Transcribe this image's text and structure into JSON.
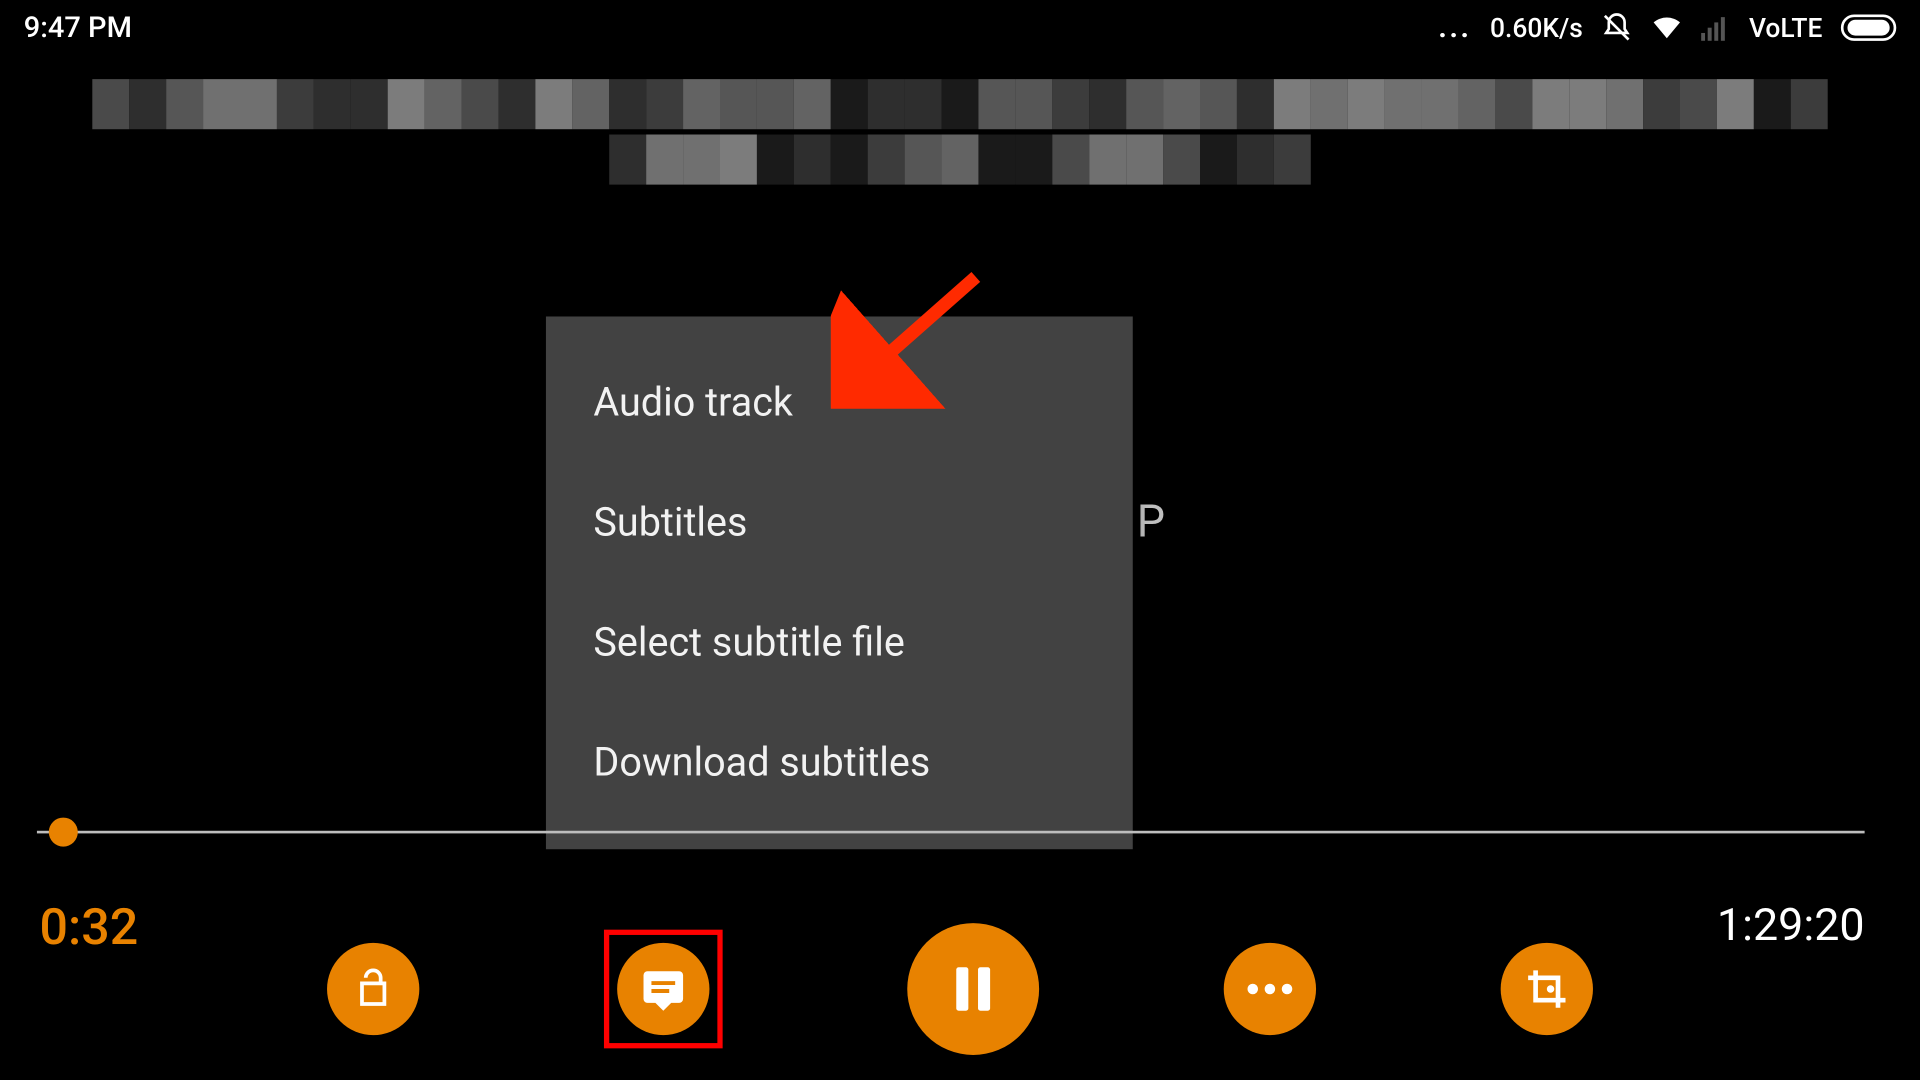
{
  "status_bar": {
    "time": "9:47 PM",
    "data_rate": "0.60K/s",
    "volte": "VoLTE"
  },
  "background_hint_letter": "P",
  "popup_menu": {
    "items": [
      {
        "label": "Audio track"
      },
      {
        "label": "Subtitles"
      },
      {
        "label": "Select subtitle file"
      },
      {
        "label": "Download subtitles"
      }
    ]
  },
  "playback": {
    "current_time": "0:32",
    "total_time": "1:29:20"
  },
  "controls": {
    "lock": "lock-open-icon",
    "subtitles": "subtitles-icon",
    "play_pause": "pause-icon",
    "more": "more-icon",
    "crop": "crop-icon"
  },
  "annotation": {
    "arrow_target": "Audio track",
    "highlighted_control": "subtitles-button"
  }
}
